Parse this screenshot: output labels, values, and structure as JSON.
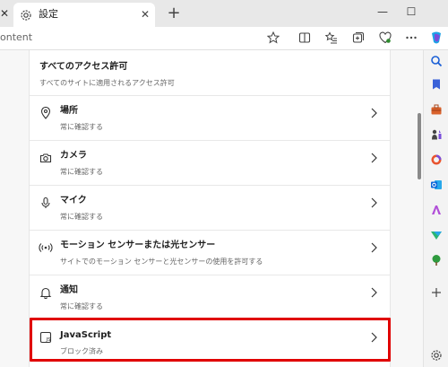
{
  "tab": {
    "left_close": "✕",
    "title": "設定",
    "close": "✕",
    "new_tab": "+"
  },
  "window": {
    "minimize": "—",
    "maximize": "☐"
  },
  "address": {
    "url_text": "ontent"
  },
  "content": {
    "title": "すべてのアクセス許可",
    "subtitle": "すべてのサイトに適用されるアクセス許可",
    "rows": [
      {
        "label": "場所",
        "sub": "常に確認する",
        "icon": "location-icon"
      },
      {
        "label": "カメラ",
        "sub": "常に確認する",
        "icon": "camera-icon"
      },
      {
        "label": "マイク",
        "sub": "常に確認する",
        "icon": "microphone-icon"
      },
      {
        "label": "モーション センサーまたは光センサー",
        "sub": "サイトでのモーション センサーと光センサーの使用を許可する",
        "icon": "motion-sensor-icon"
      },
      {
        "label": "通知",
        "sub": "常に確認する",
        "icon": "bell-icon"
      },
      {
        "label": "JavaScript",
        "sub": "ブロック済み",
        "icon": "javascript-icon"
      }
    ]
  },
  "colors": {
    "highlight": "#e00000",
    "edge_blue": "#0a64d8"
  }
}
